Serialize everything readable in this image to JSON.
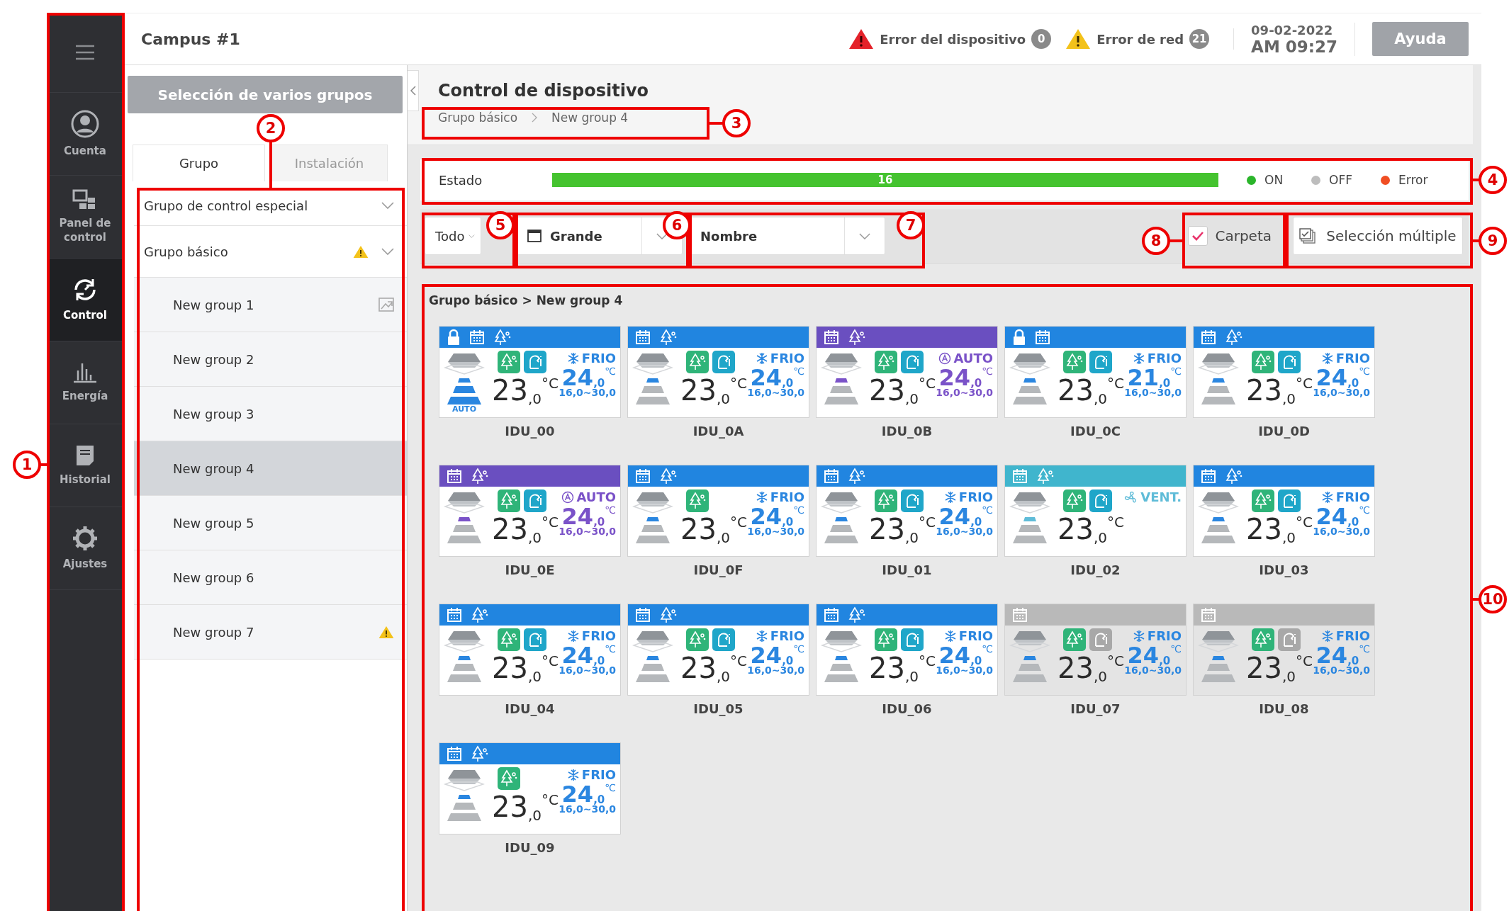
{
  "sidebar": {
    "items": [
      {
        "kind": "account",
        "label": "Cuenta",
        "selected": false
      },
      {
        "kind": "dashboard",
        "label": "Panel de control",
        "selected": false
      },
      {
        "kind": "control",
        "label": "Control",
        "selected": true
      },
      {
        "kind": "energy",
        "label": "Energía",
        "selected": false
      },
      {
        "kind": "history",
        "label": "Historial",
        "selected": false
      },
      {
        "kind": "settings",
        "label": "Ajustes",
        "selected": false
      }
    ]
  },
  "header": {
    "title": "Campus #1",
    "device_error": {
      "label": "Error del dispositivo",
      "count": "0"
    },
    "network_error": {
      "label": "Error de red",
      "count": "21"
    },
    "date": "09-02-2022",
    "time": "AM 09:27",
    "help_button": "Ayuda"
  },
  "group_panel": {
    "multi_select_button": "Selección de varios grupos",
    "tabs": [
      {
        "label": "Grupo",
        "selected": true
      },
      {
        "label": "Instalación",
        "selected": false
      }
    ],
    "groups": [
      {
        "label": "Grupo de control especial",
        "warning": false
      },
      {
        "label": "Grupo básico",
        "warning": true,
        "children": [
          {
            "label": "New group 1",
            "selected": false,
            "warning": false,
            "layout_icon": true
          },
          {
            "label": "New group 2",
            "selected": false,
            "warning": false,
            "layout_icon": false
          },
          {
            "label": "New group 3",
            "selected": false,
            "warning": false,
            "layout_icon": false
          },
          {
            "label": "New group 4",
            "selected": true,
            "warning": false,
            "layout_icon": false
          },
          {
            "label": "New group 5",
            "selected": false,
            "warning": false,
            "layout_icon": false
          },
          {
            "label": "New group 6",
            "selected": false,
            "warning": false,
            "layout_icon": false
          },
          {
            "label": "New group 7",
            "selected": false,
            "warning": true,
            "layout_icon": false
          }
        ]
      }
    ]
  },
  "device_control": {
    "title": "Control de dispositivo",
    "breadcrumb": [
      "Grupo básico",
      "New group 4"
    ],
    "status": {
      "label": "Estado",
      "level": 1,
      "count": "16",
      "legend": [
        {
          "label": "ON",
          "color": "#2bb52b"
        },
        {
          "label": "OFF",
          "color": "#bdbdbd"
        },
        {
          "label": "Error",
          "color": "#f04e23"
        }
      ]
    },
    "toolbar": {
      "filter": "Todo",
      "view": "Grande",
      "sort": "Nombre",
      "folder": {
        "label": "Carpeta",
        "checked": true
      },
      "multi_select_button": "Selección múltiple"
    },
    "path": "Grupo básico > New group 4",
    "devices": [
      {
        "name": "IDU_00",
        "kind": "cool",
        "on": true,
        "locked": true,
        "eco_header": true,
        "comfort": true,
        "fan_label": "AUTO",
        "mode_label": "FRIO",
        "current": "23",
        "current_decimal": ",0",
        "current_unit": "°C",
        "setpoint": "24",
        "setpoint_decimal": ",0",
        "setpoint_unit": "℃",
        "range": "16,0~30,0"
      },
      {
        "name": "IDU_0A",
        "kind": "cool",
        "on": true,
        "locked": false,
        "eco_header": true,
        "comfort": true,
        "mode_label": "FRIO",
        "current": "23",
        "current_decimal": ",0",
        "current_unit": "°C",
        "setpoint": "24",
        "setpoint_decimal": ",0",
        "setpoint_unit": "℃",
        "range": "16,0~30,0"
      },
      {
        "name": "IDU_0B",
        "kind": "auto",
        "on": true,
        "locked": false,
        "eco_header": true,
        "comfort": true,
        "mode_label": "AUTO",
        "current": "23",
        "current_decimal": ",0",
        "current_unit": "°C",
        "setpoint": "24",
        "setpoint_decimal": ",0",
        "setpoint_unit": "℃",
        "range": "16,0~30,0"
      },
      {
        "name": "IDU_0C",
        "kind": "cool",
        "on": true,
        "locked": true,
        "eco_header": false,
        "comfort": true,
        "mode_label": "FRIO",
        "current": "23",
        "current_decimal": ",0",
        "current_unit": "°C",
        "setpoint": "21",
        "setpoint_decimal": ",0",
        "setpoint_unit": "℃",
        "range": "16,0~30,0"
      },
      {
        "name": "IDU_0D",
        "kind": "cool",
        "on": true,
        "locked": false,
        "eco_header": true,
        "comfort": true,
        "mode_label": "FRIO",
        "current": "23",
        "current_decimal": ",0",
        "current_unit": "°C",
        "setpoint": "24",
        "setpoint_decimal": ",0",
        "setpoint_unit": "℃",
        "range": "16,0~30,0"
      },
      {
        "name": "IDU_0E",
        "kind": "auto",
        "on": true,
        "locked": false,
        "eco_header": true,
        "comfort": true,
        "mode_label": "AUTO",
        "current": "23",
        "current_decimal": ",0",
        "current_unit": "°C",
        "setpoint": "24",
        "setpoint_decimal": ",0",
        "setpoint_unit": "℃",
        "range": "16,0~30,0"
      },
      {
        "name": "IDU_0F",
        "kind": "cool",
        "on": true,
        "locked": false,
        "eco_header": true,
        "comfort": false,
        "mode_label": "FRIO",
        "current": "23",
        "current_decimal": ",0",
        "current_unit": "°C",
        "setpoint": "24",
        "setpoint_decimal": ",0",
        "setpoint_unit": "℃",
        "range": "16,0~30,0"
      },
      {
        "name": "IDU_01",
        "kind": "cool",
        "on": true,
        "locked": false,
        "eco_header": true,
        "comfort": true,
        "mode_label": "FRIO",
        "current": "23",
        "current_decimal": ",0",
        "current_unit": "°C",
        "setpoint": "24",
        "setpoint_decimal": ",0",
        "setpoint_unit": "℃",
        "range": "16,0~30,0"
      },
      {
        "name": "IDU_02",
        "kind": "fan",
        "on": true,
        "locked": false,
        "eco_header": true,
        "comfort": true,
        "mode_label": "VENT.",
        "current": "23",
        "current_decimal": ",0",
        "current_unit": "°C"
      },
      {
        "name": "IDU_03",
        "kind": "cool",
        "on": true,
        "locked": false,
        "eco_header": true,
        "comfort": true,
        "mode_label": "FRIO",
        "current": "23",
        "current_decimal": ",0",
        "current_unit": "°C",
        "setpoint": "24",
        "setpoint_decimal": ",0",
        "setpoint_unit": "℃",
        "range": "16,0~30,0"
      },
      {
        "name": "IDU_04",
        "kind": "cool",
        "on": true,
        "locked": false,
        "eco_header": true,
        "comfort": true,
        "mode_label": "FRIO",
        "current": "23",
        "current_decimal": ",0",
        "current_unit": "°C",
        "setpoint": "24",
        "setpoint_decimal": ",0",
        "setpoint_unit": "℃",
        "range": "16,0~30,0"
      },
      {
        "name": "IDU_05",
        "kind": "cool",
        "on": true,
        "locked": false,
        "eco_header": true,
        "comfort": true,
        "mode_label": "FRIO",
        "current": "23",
        "current_decimal": ",0",
        "current_unit": "°C",
        "setpoint": "24",
        "setpoint_decimal": ",0",
        "setpoint_unit": "℃",
        "range": "16,0~30,0"
      },
      {
        "name": "IDU_06",
        "kind": "cool",
        "on": true,
        "locked": false,
        "eco_header": true,
        "comfort": true,
        "mode_label": "FRIO",
        "current": "23",
        "current_decimal": ",0",
        "current_unit": "°C",
        "setpoint": "24",
        "setpoint_decimal": ",0",
        "setpoint_unit": "℃",
        "range": "16,0~30,0"
      },
      {
        "name": "IDU_07",
        "kind": "cool",
        "on": false,
        "locked": false,
        "eco_header": false,
        "comfort": true,
        "mode_label": "FRIO",
        "current": "23",
        "current_decimal": ",0",
        "current_unit": "°C",
        "setpoint": "24",
        "setpoint_decimal": ",0",
        "setpoint_unit": "℃",
        "range": "16,0~30,0"
      },
      {
        "name": "IDU_08",
        "kind": "cool",
        "on": false,
        "locked": false,
        "eco_header": false,
        "comfort": true,
        "mode_label": "FRIO",
        "current": "23",
        "current_decimal": ",0",
        "current_unit": "°C",
        "setpoint": "24",
        "setpoint_decimal": ",0",
        "setpoint_unit": "℃",
        "range": "16,0~30,0"
      },
      {
        "name": "IDU_09",
        "kind": "cool",
        "on": true,
        "locked": false,
        "eco_header": true,
        "comfort": false,
        "mode_label": "FRIO",
        "current": "23",
        "current_decimal": ",0",
        "current_unit": "°C",
        "setpoint": "24",
        "setpoint_decimal": ",0",
        "setpoint_unit": "℃",
        "range": "16,0~30,0"
      }
    ]
  },
  "annotations": [
    {
      "number": "1"
    },
    {
      "number": "2"
    },
    {
      "number": "3"
    },
    {
      "number": "4"
    },
    {
      "number": "5"
    },
    {
      "number": "6"
    },
    {
      "number": "7"
    },
    {
      "number": "8"
    },
    {
      "number": "9"
    },
    {
      "number": "10"
    }
  ]
}
